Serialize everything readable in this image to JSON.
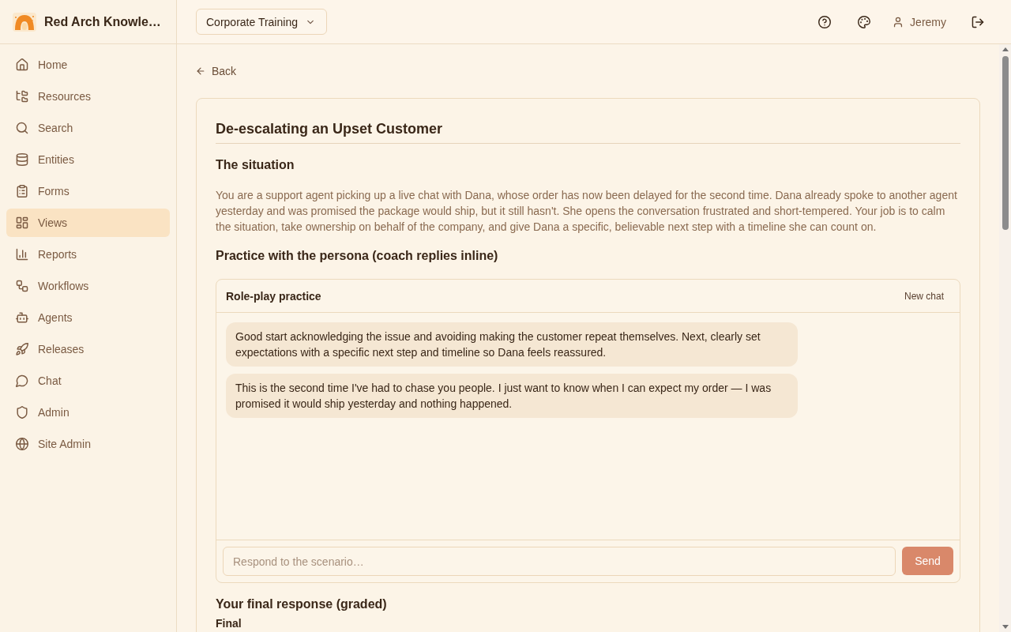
{
  "app": {
    "title": "Red Arch Knowle…"
  },
  "sidebar": {
    "items": [
      {
        "label": "Home",
        "selected": false
      },
      {
        "label": "Resources",
        "selected": false
      },
      {
        "label": "Search",
        "selected": false
      },
      {
        "label": "Entities",
        "selected": false
      },
      {
        "label": "Forms",
        "selected": false
      },
      {
        "label": "Views",
        "selected": true
      },
      {
        "label": "Reports",
        "selected": false
      },
      {
        "label": "Workflows",
        "selected": false
      },
      {
        "label": "Agents",
        "selected": false
      },
      {
        "label": "Releases",
        "selected": false
      },
      {
        "label": "Chat",
        "selected": false
      },
      {
        "label": "Admin",
        "selected": false
      },
      {
        "label": "Site Admin",
        "selected": false
      }
    ]
  },
  "topbar": {
    "workspace_selector": "Corporate Training",
    "user_name": "Jeremy"
  },
  "back_link": "Back",
  "scenario": {
    "title": "De-escalating an Upset Customer",
    "situation_heading": "The situation",
    "situation_text": "You are a support agent picking up a live chat with Dana, whose order has now been delayed for the second time. Dana already spoke to another agent yesterday and was promised the package would ship, but it still hasn't. She opens the conversation frustrated and short-tempered. Your job is to calm the situation, take ownership on behalf of the company, and give Dana a specific, believable next step with a timeline she can count on.",
    "practice_heading": "Practice with the persona (coach replies inline)",
    "chat": {
      "title": "Role-play practice",
      "new_chat_button": "New chat",
      "messages": [
        {
          "text": "Good start acknowledging the issue and avoiding making the customer repeat themselves. Next, clearly set expectations with a specific next step and timeline so Dana feels reassured."
        },
        {
          "text": "This is the second time I've had to chase you people. I just want to know when I can expect my order — I was promised it would ship yesterday and nothing happened."
        }
      ],
      "input": {
        "placeholder": "Respond to the scenario…"
      },
      "send_button": "Send"
    },
    "final_heading": "Your final response (graded)",
    "final_label": "Final"
  }
}
